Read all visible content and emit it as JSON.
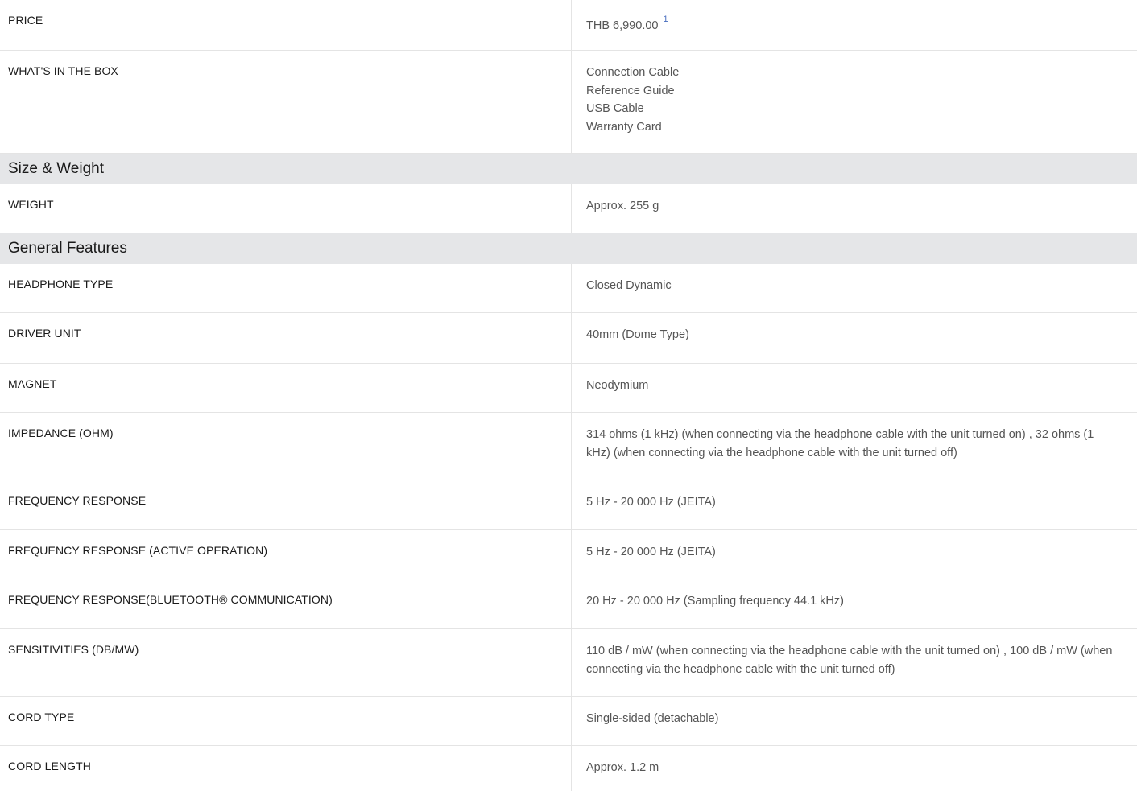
{
  "rows_top": [
    {
      "label": "PRICE",
      "value": "THB 6,990.00",
      "sup": "1"
    },
    {
      "label": "WHAT'S IN THE BOX",
      "values": [
        "Connection Cable",
        "Reference Guide",
        "USB Cable",
        "Warranty Card"
      ]
    }
  ],
  "size_weight": {
    "title": "Size & Weight",
    "rows": [
      {
        "label": "WEIGHT",
        "value": "Approx. 255 g"
      }
    ]
  },
  "general": {
    "title": "General Features",
    "rows": [
      {
        "label": "HEADPHONE TYPE",
        "value": "Closed Dynamic"
      },
      {
        "label": "DRIVER UNIT",
        "value": "40mm (Dome Type)"
      },
      {
        "label": "MAGNET",
        "value": "Neodymium"
      },
      {
        "label": "IMPEDANCE (OHM)",
        "value": "314 ohms (1 kHz) (when connecting via the headphone cable with the unit turned on) , 32 ohms (1 kHz) (when connecting via the headphone cable with the unit turned off)"
      },
      {
        "label": "FREQUENCY RESPONSE",
        "value": "5 Hz - 20 000 Hz (JEITA)"
      },
      {
        "label": "FREQUENCY RESPONSE (ACTIVE OPERATION)",
        "value": "5 Hz - 20 000 Hz (JEITA)"
      },
      {
        "label": "FREQUENCY RESPONSE(BLUETOOTH® COMMUNICATION)",
        "value": "20 Hz - 20 000 Hz (Sampling frequency 44.1 kHz)"
      },
      {
        "label": "SENSITIVITIES (DB/MW)",
        "value": "110 dB / mW (when connecting via the headphone cable with the unit turned on) , 100 dB / mW (when connecting via the headphone cable with the unit turned off)"
      },
      {
        "label": "CORD TYPE",
        "value": "Single-sided (detachable)"
      },
      {
        "label": "CORD LENGTH",
        "value": "Approx. 1.2 m"
      }
    ]
  }
}
